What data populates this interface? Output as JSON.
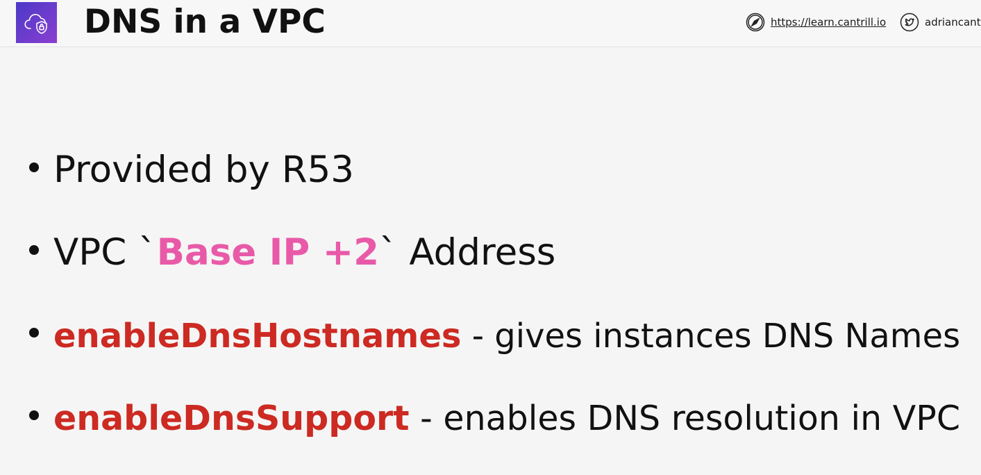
{
  "header": {
    "title": "DNS in a VPC",
    "website": "https://learn.cantrill.io",
    "twitter_handle": "adriancantr"
  },
  "bullets": [
    {
      "text": "Provided by R53"
    },
    {
      "prefix": "VPC `",
      "highlight": "Base IP +2",
      "suffix": "` Address"
    },
    {
      "keyword": "enableDnsHostnames",
      "rest": " - gives instances DNS Names"
    },
    {
      "keyword": "enableDnsSupport",
      "rest": " - enables DNS resolution in VPC"
    }
  ],
  "colors": {
    "highlight_pink": "#e85aa8",
    "keyword_red": "#cc2a22",
    "logo_purple": "#5b3bcc"
  },
  "icons": {
    "logo": "cloud-shield-icon",
    "website": "compass-icon",
    "twitter": "twitter-bird-icon"
  }
}
